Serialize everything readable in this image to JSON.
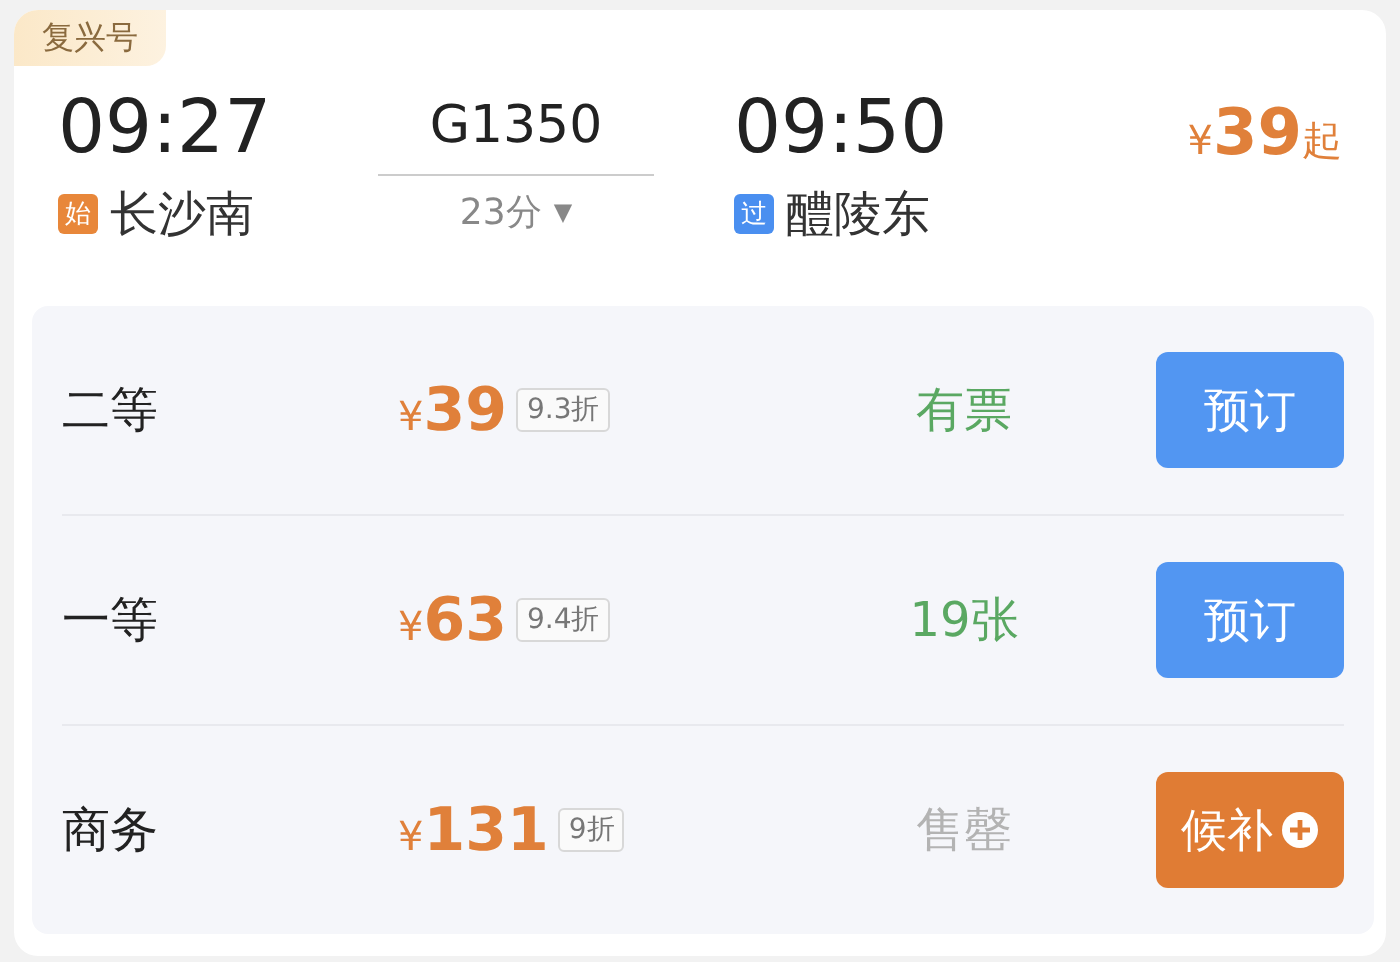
{
  "train_type": "复兴号",
  "departure": {
    "time": "09:27",
    "station_tag": {
      "kind": "start",
      "label": "始"
    },
    "station": "长沙南"
  },
  "train": {
    "number": "G1350",
    "duration": "23分",
    "dropdown_icon": "▼"
  },
  "arrival": {
    "time": "09:50",
    "station_tag": {
      "kind": "pass",
      "label": "过"
    },
    "station": "醴陵东"
  },
  "from_price": {
    "currency": "¥",
    "amount": "39",
    "suffix": "起"
  },
  "seats": [
    {
      "class": "二等",
      "currency": "¥",
      "amount": "39",
      "discount": "9.3折",
      "availability": {
        "kind": "available",
        "label": "有票"
      },
      "button": {
        "kind": "book",
        "label": "预订"
      }
    },
    {
      "class": "一等",
      "currency": "¥",
      "amount": "63",
      "discount": "9.4折",
      "availability": {
        "kind": "available",
        "label": "19张"
      },
      "button": {
        "kind": "book",
        "label": "预订"
      }
    },
    {
      "class": "商务",
      "currency": "¥",
      "amount": "131",
      "discount": "9折",
      "availability": {
        "kind": "soldout",
        "label": "售罄"
      },
      "button": {
        "kind": "waitlist",
        "label": "候补"
      }
    }
  ]
}
